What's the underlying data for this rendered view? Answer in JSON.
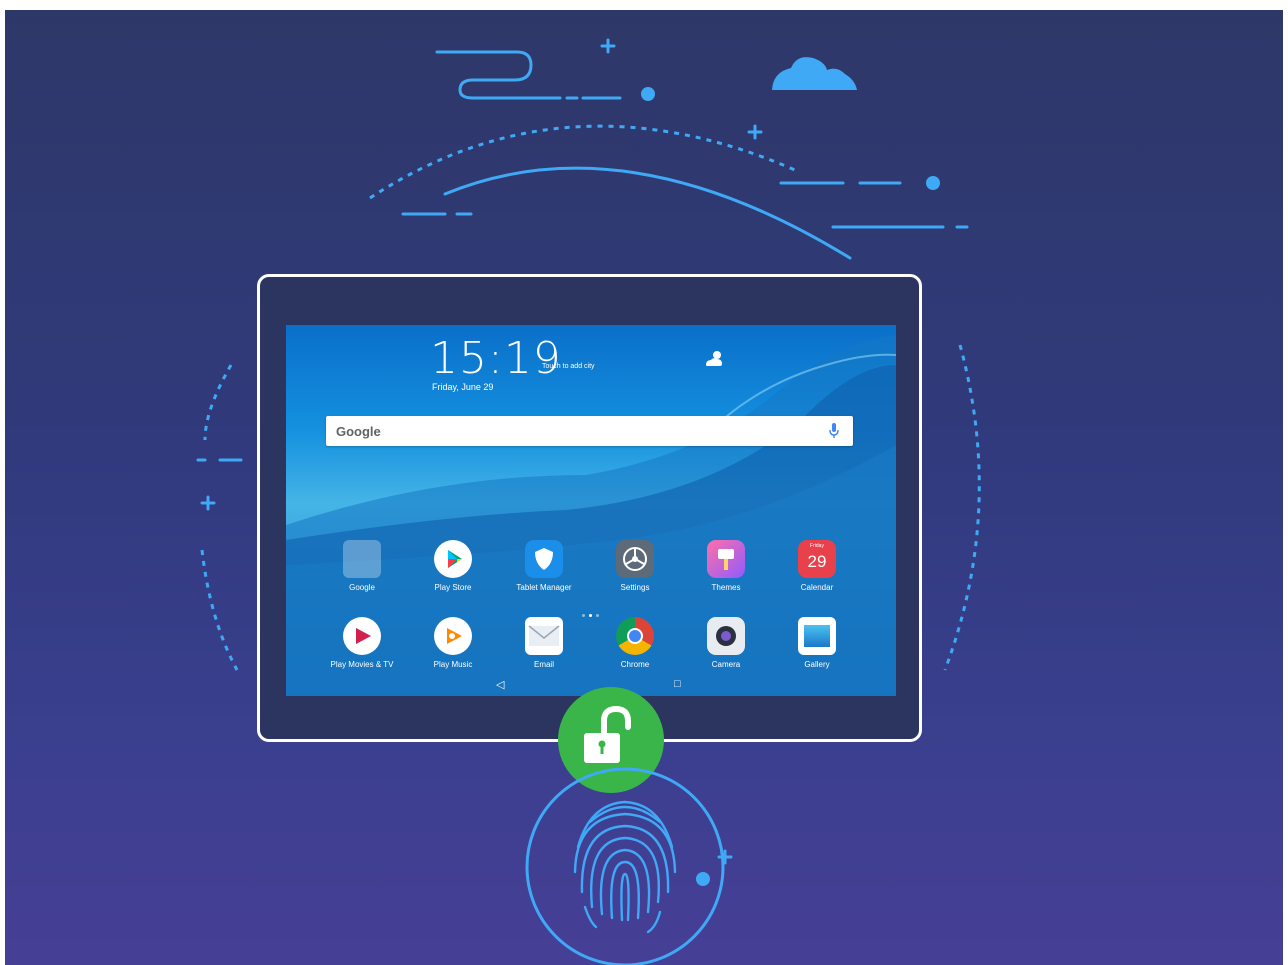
{
  "lockscreen": {
    "time": "15:19",
    "city_hint": "Touch to add city",
    "date": "Friday, June 29"
  },
  "search": {
    "brand": "Google",
    "icon": "mic-icon"
  },
  "apps_row1": [
    {
      "label": "Google",
      "icon": "google-folder-icon"
    },
    {
      "label": "Play Store",
      "icon": "play-store-icon"
    },
    {
      "label": "Tablet Manager",
      "icon": "shield-icon"
    },
    {
      "label": "Settings",
      "icon": "gear-icon"
    },
    {
      "label": "Themes",
      "icon": "brush-icon"
    },
    {
      "label": "Calendar",
      "icon": "calendar-icon",
      "day": "Friday",
      "date": "29"
    }
  ],
  "apps_row2": [
    {
      "label": "Play Movies & TV",
      "icon": "movie-icon"
    },
    {
      "label": "Play Music",
      "icon": "music-icon"
    },
    {
      "label": "Email",
      "icon": "envelope-icon"
    },
    {
      "label": "Chrome",
      "icon": "chrome-icon"
    },
    {
      "label": "Camera",
      "icon": "camera-icon"
    },
    {
      "label": "Gallery",
      "icon": "gallery-icon"
    }
  ],
  "page_indicator": {
    "pages": 3,
    "current": 2
  },
  "navbar": {
    "back": "◁",
    "recents": "□"
  },
  "colors": {
    "background": "#303a7c",
    "accent_line": "#3fa9f5",
    "unlock_badge": "#3ab54a",
    "tablet_border": "#ffffff"
  }
}
